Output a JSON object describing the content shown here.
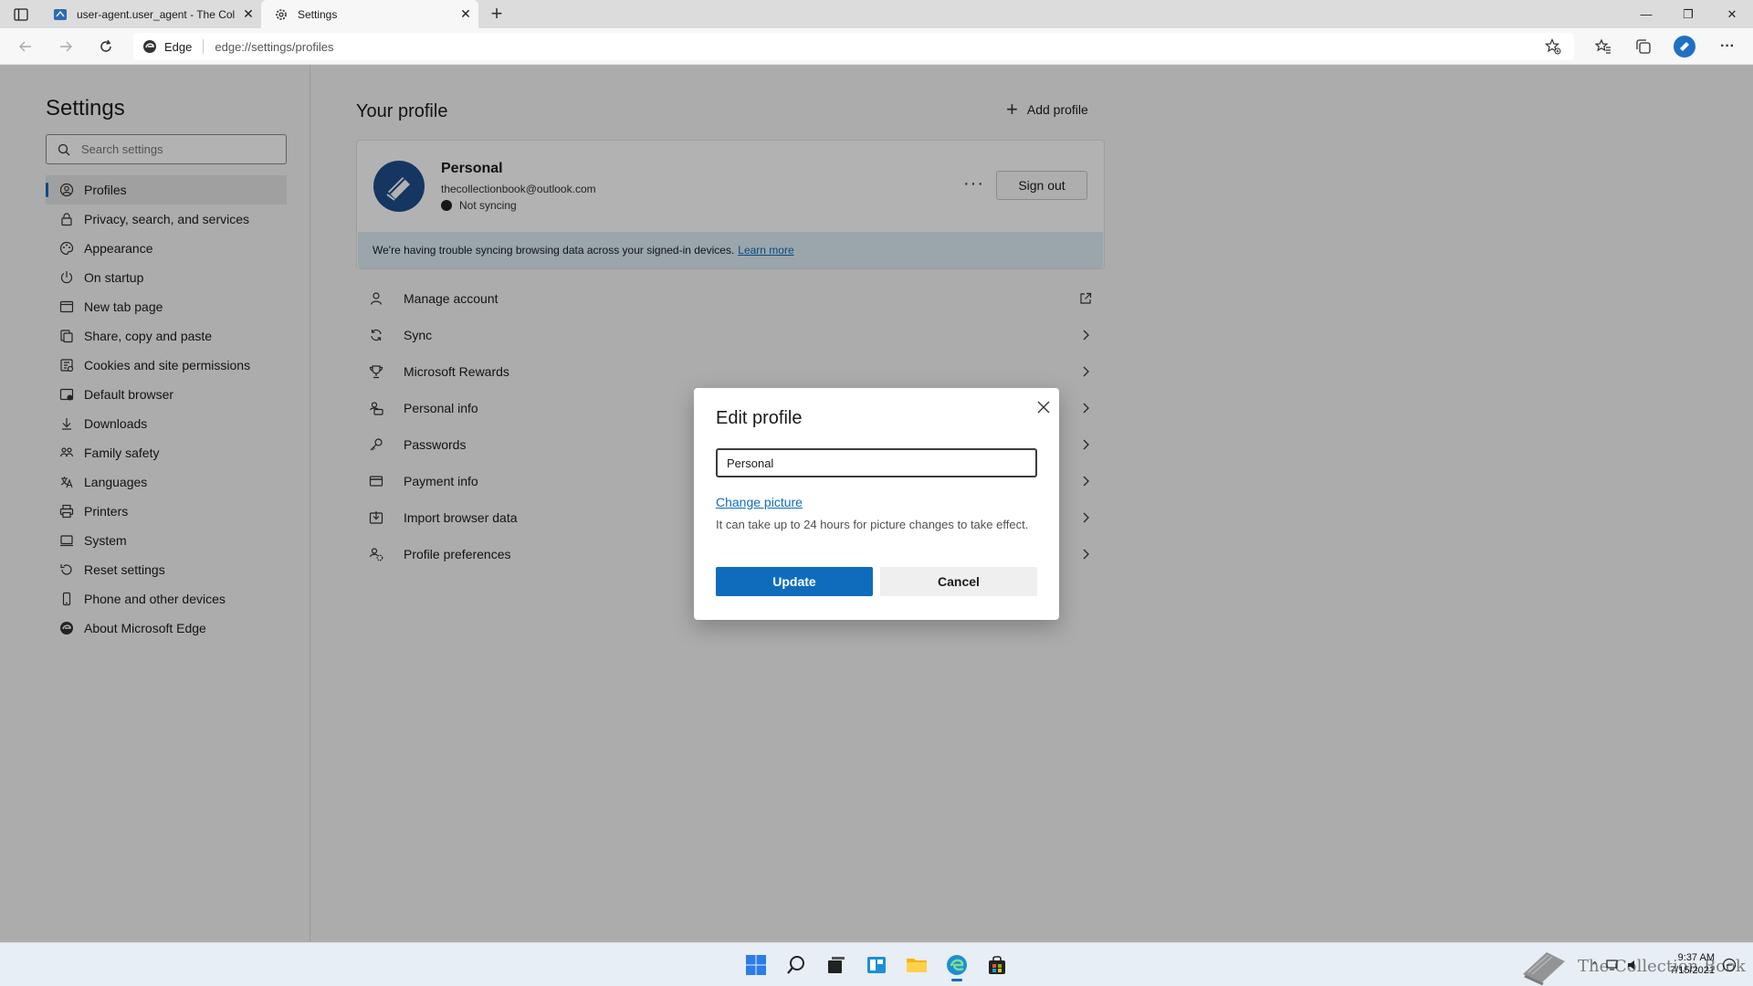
{
  "tabs": [
    {
      "title": "user-agent.user_agent - The Coll",
      "close": "✕"
    },
    {
      "title": "Settings",
      "close": "✕"
    }
  ],
  "window_controls": {
    "minimize": "—",
    "maximize": "❐",
    "close": "✕"
  },
  "address_bar": {
    "chip_label": "Edge",
    "url": "edge://settings/profiles"
  },
  "sidebar": {
    "title": "Settings",
    "search_placeholder": "Search settings",
    "items": [
      {
        "label": "Profiles",
        "icon": "profile-icon"
      },
      {
        "label": "Privacy, search, and services",
        "icon": "lock-icon"
      },
      {
        "label": "Appearance",
        "icon": "palette-icon"
      },
      {
        "label": "On startup",
        "icon": "power-icon"
      },
      {
        "label": "New tab page",
        "icon": "newtab-icon"
      },
      {
        "label": "Share, copy and paste",
        "icon": "share-icon"
      },
      {
        "label": "Cookies and site permissions",
        "icon": "cookie-icon"
      },
      {
        "label": "Default browser",
        "icon": "browser-icon"
      },
      {
        "label": "Downloads",
        "icon": "download-icon"
      },
      {
        "label": "Family safety",
        "icon": "family-icon"
      },
      {
        "label": "Languages",
        "icon": "language-icon"
      },
      {
        "label": "Printers",
        "icon": "printer-icon"
      },
      {
        "label": "System",
        "icon": "system-icon"
      },
      {
        "label": "Reset settings",
        "icon": "reset-icon"
      },
      {
        "label": "Phone and other devices",
        "icon": "phone-icon"
      },
      {
        "label": "About Microsoft Edge",
        "icon": "edge-icon"
      }
    ]
  },
  "main": {
    "heading": "Your profile",
    "add_profile": "Add profile",
    "profile": {
      "name": "Personal",
      "email": "thecollectionbook@outlook.com",
      "sync_status": "Not syncing",
      "more": "···",
      "sign_out": "Sign out",
      "banner_text": "We're having trouble syncing browsing data across your signed-in devices.",
      "banner_link": "Learn more"
    },
    "rows": [
      {
        "label": "Manage account"
      },
      {
        "label": "Sync"
      },
      {
        "label": "Microsoft Rewards"
      },
      {
        "label": "Personal info"
      },
      {
        "label": "Passwords"
      },
      {
        "label": "Payment info"
      },
      {
        "label": "Import browser data"
      },
      {
        "label": "Profile preferences"
      }
    ]
  },
  "dialog": {
    "title": "Edit profile",
    "name_value": "Personal",
    "change_picture": "Change picture",
    "note": "It can take up to 24 hours for picture changes to take effect.",
    "update": "Update",
    "cancel": "Cancel"
  },
  "taskbar": {
    "clock_time": "9:37 AM",
    "clock_date": "7/15/2021",
    "watermark": "The Collection Book"
  },
  "colors": {
    "accent": "#0f6cbd",
    "banner": "#ddecf7"
  }
}
